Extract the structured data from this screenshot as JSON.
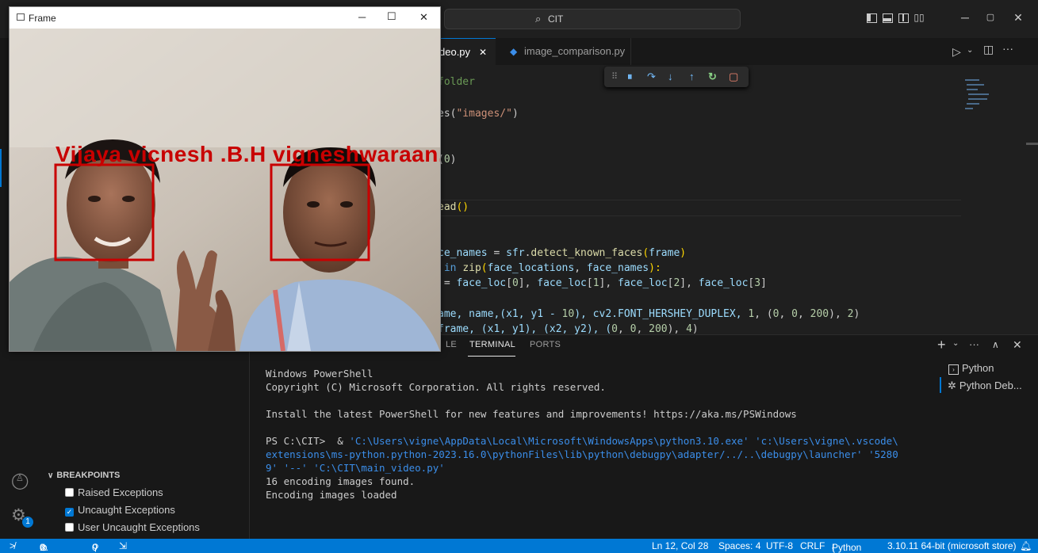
{
  "window": {
    "command_center": "CIT"
  },
  "tabs": [
    {
      "label": "deo.py",
      "close": "✕"
    },
    {
      "label": "image_comparison.py"
    }
  ],
  "editor": {
    "lines": [
      {
        "parts": [
          {
            "t": "folder",
            "c": "c"
          }
        ]
      },
      {
        "parts": [
          {
            "t": "es(",
            "c": ""
          },
          {
            "t": "\"images/\"",
            "c": "s"
          },
          {
            "t": ")",
            "c": ""
          }
        ]
      },
      {
        "parts": [
          {
            "t": "(",
            "c": ""
          },
          {
            "t": "0",
            "c": "n"
          },
          {
            "t": ")",
            "c": ""
          }
        ]
      },
      {
        "parts": [
          {
            "t": "ead",
            "c": "f"
          },
          {
            "t": "()",
            "c": "y"
          }
        ]
      },
      {
        "parts": [
          {
            "t": "ce_names",
            "c": "v"
          },
          {
            "t": " = ",
            "c": ""
          },
          {
            "t": "sfr",
            "c": "v"
          },
          {
            "t": ".",
            "c": ""
          },
          {
            "t": "detect_known_faces",
            "c": "f"
          },
          {
            "t": "(",
            "c": "y"
          },
          {
            "t": "frame",
            "c": "v"
          },
          {
            "t": ")",
            "c": "y"
          }
        ]
      },
      {
        "parts": [
          {
            "t": " in ",
            "c": "k"
          },
          {
            "t": "zip",
            "c": "f"
          },
          {
            "t": "(",
            "c": "y"
          },
          {
            "t": "face_locations",
            "c": "v"
          },
          {
            "t": ", ",
            "c": ""
          },
          {
            "t": "face_names",
            "c": "v"
          },
          {
            "t": "):",
            "c": "y"
          }
        ]
      },
      {
        "parts": [
          {
            "t": " = ",
            "c": ""
          },
          {
            "t": "face_loc",
            "c": "v"
          },
          {
            "t": "[",
            "c": ""
          },
          {
            "t": "0",
            "c": "n"
          },
          {
            "t": "], ",
            "c": ""
          },
          {
            "t": "face_loc",
            "c": "v"
          },
          {
            "t": "[",
            "c": ""
          },
          {
            "t": "1",
            "c": "n"
          },
          {
            "t": "], ",
            "c": ""
          },
          {
            "t": "face_loc",
            "c": "v"
          },
          {
            "t": "[",
            "c": ""
          },
          {
            "t": "2",
            "c": "n"
          },
          {
            "t": "], ",
            "c": ""
          },
          {
            "t": "face_loc",
            "c": "v"
          },
          {
            "t": "[",
            "c": ""
          },
          {
            "t": "3",
            "c": "n"
          },
          {
            "t": "]",
            "c": ""
          }
        ]
      },
      {
        "parts": [
          {
            "t": "ame, name,(x1, y1 - ",
            "c": "v"
          },
          {
            "t": "10",
            "c": "n"
          },
          {
            "t": "), cv2.FONT_HERSHEY_DUPLEX, ",
            "c": "v"
          },
          {
            "t": "1",
            "c": "n"
          },
          {
            "t": ", (",
            "c": ""
          },
          {
            "t": "0",
            "c": "n"
          },
          {
            "t": ", ",
            "c": ""
          },
          {
            "t": "0",
            "c": "n"
          },
          {
            "t": ", ",
            "c": ""
          },
          {
            "t": "200",
            "c": "n"
          },
          {
            "t": "), ",
            "c": ""
          },
          {
            "t": "2",
            "c": "n"
          },
          {
            "t": ")",
            "c": ""
          }
        ]
      },
      {
        "parts": [
          {
            "t": "frame, (x1, y1), (x2, y2), (",
            "c": "v"
          },
          {
            "t": "0",
            "c": "n"
          },
          {
            "t": ", ",
            "c": ""
          },
          {
            "t": "0",
            "c": "n"
          },
          {
            "t": ", ",
            "c": ""
          },
          {
            "t": "200",
            "c": "n"
          },
          {
            "t": "), ",
            "c": ""
          },
          {
            "t": "4",
            "c": "n"
          },
          {
            "t": ")",
            "c": ""
          }
        ]
      }
    ]
  },
  "panel": {
    "tab_partial": "LE",
    "tab_terminal": "TERMINAL",
    "tab_ports": "PORTS",
    "terminals": [
      "Python",
      "Python Deb..."
    ],
    "terminal_lines": [
      {
        "text": "Windows PowerShell"
      },
      {
        "text": "Copyright (C) Microsoft Corporation. All rights reserved."
      },
      {
        "text": ""
      },
      {
        "text": "Install the latest PowerShell for new features and improvements! https://aka.ms/PSWindows"
      },
      {
        "text": ""
      },
      {
        "prefix": "PS C:\\CIT>  & ",
        "path": "'C:\\Users\\vigne\\AppData\\Local\\Microsoft\\WindowsApps\\python3.10.exe' 'c:\\Users\\vigne\\.vscode\\"
      },
      {
        "path": "extensions\\ms-python.python-2023.16.0\\pythonFiles\\lib\\python\\debugpy\\adapter/../..\\debugpy\\launcher' '5280"
      },
      {
        "path": "9' '--' 'C:\\CIT\\main_video.py'"
      },
      {
        "text": "16 encoding images found."
      },
      {
        "text": "Encoding images loaded"
      }
    ]
  },
  "breakpoints": {
    "header": "BREAKPOINTS",
    "items": [
      {
        "label": "Raised Exceptions",
        "checked": false
      },
      {
        "label": "Uncaught Exceptions",
        "checked": true
      },
      {
        "label": "User Uncaught Exceptions",
        "checked": false
      }
    ]
  },
  "statusbar": {
    "errors": "0",
    "warnings": "0",
    "ports": "0",
    "position": "Ln 12, Col 28",
    "spaces": "Spaces: 4",
    "encoding": "UTF-8",
    "eol": "CRLF",
    "language": "Python",
    "interpreter": "3.10.11 64-bit (microsoft store)"
  },
  "frame_window": {
    "title": "Frame",
    "face_label": "Vijaya vicnesh .B.H vigneshwaraan.",
    "box_color": "#c80000"
  },
  "accounts_badge": "1",
  "colors": {
    "accent": "#0078d4",
    "editor_bg": "#1f1f1f",
    "panel_bg": "#181818"
  }
}
